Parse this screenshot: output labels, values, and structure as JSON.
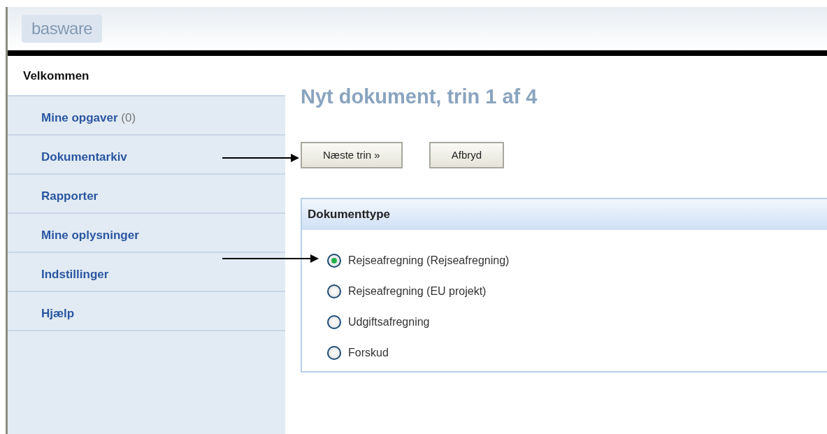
{
  "header": {
    "logo": "basware"
  },
  "sidebar": {
    "heading": "Velkommen",
    "items": [
      {
        "label": "Mine opgaver",
        "count": "(0)"
      },
      {
        "label": "Dokumentarkiv"
      },
      {
        "label": "Rapporter"
      },
      {
        "label": "Mine oplysninger"
      },
      {
        "label": "Indstillinger"
      },
      {
        "label": "Hjælp"
      }
    ]
  },
  "page": {
    "title": "Nyt dokument, trin 1 af 4",
    "buttons": [
      "Næste trin »",
      "Afbryd"
    ]
  },
  "document_type": {
    "heading": "Dokumenttype",
    "options": [
      {
        "label": "Rejseafregning (Rejseafregning)",
        "selected": true
      },
      {
        "label": "Rejseafregning (EU projekt)",
        "selected": false
      },
      {
        "label": "Udgiftsafregning",
        "selected": false
      },
      {
        "label": "Forskud",
        "selected": false
      }
    ]
  },
  "annotations": [
    {
      "kind": "arrow"
    },
    {
      "kind": "arrow"
    }
  ]
}
